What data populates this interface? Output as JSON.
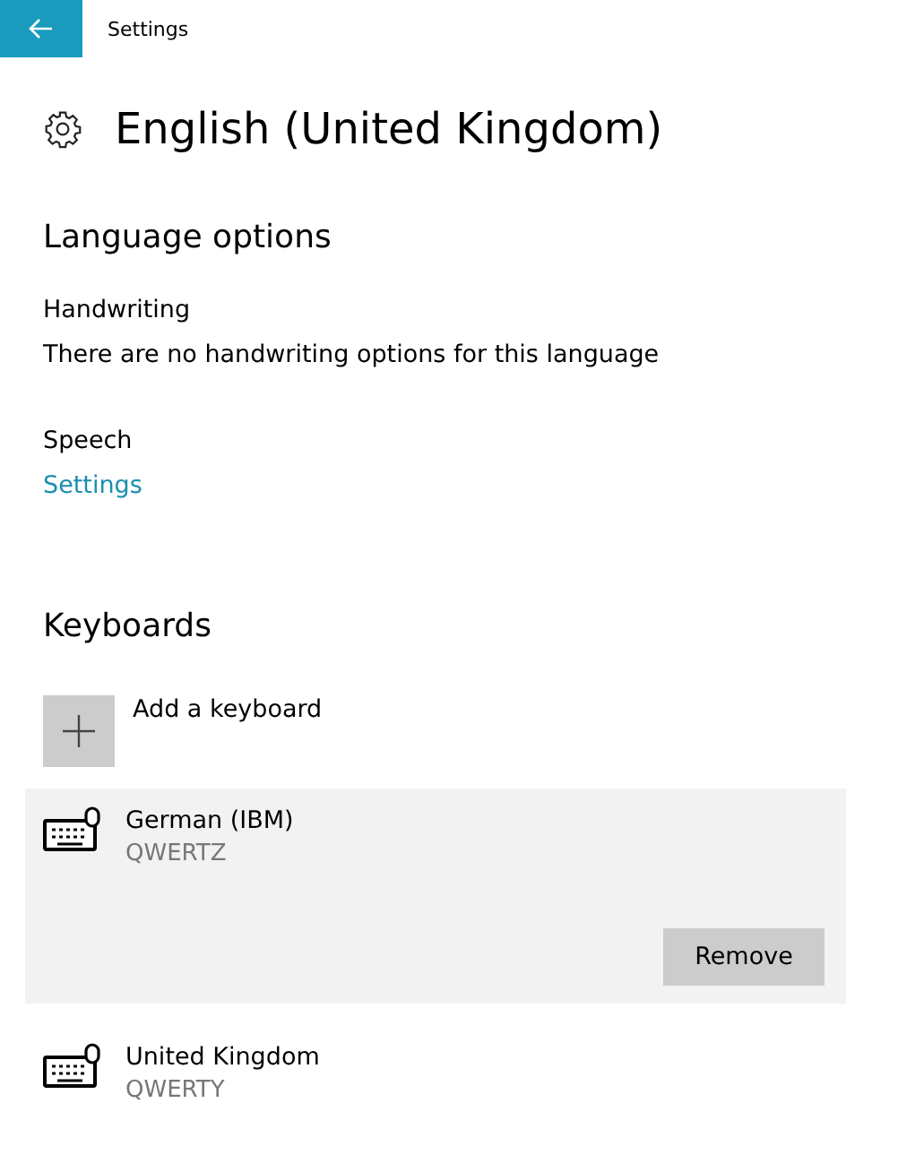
{
  "window": {
    "title": "Settings"
  },
  "page": {
    "title": "English (United Kingdom)"
  },
  "language_options": {
    "heading": "Language options",
    "handwriting": {
      "label": "Handwriting",
      "text": "There are no handwriting options for this language"
    },
    "speech": {
      "label": "Speech",
      "link": "Settings"
    }
  },
  "keyboards": {
    "heading": "Keyboards",
    "add_label": "Add a keyboard",
    "items": [
      {
        "name": "German (IBM)",
        "layout": "QWERTZ",
        "selected": true,
        "action": "Remove"
      },
      {
        "name": "United Kingdom",
        "layout": "QWERTY",
        "selected": false
      }
    ]
  }
}
